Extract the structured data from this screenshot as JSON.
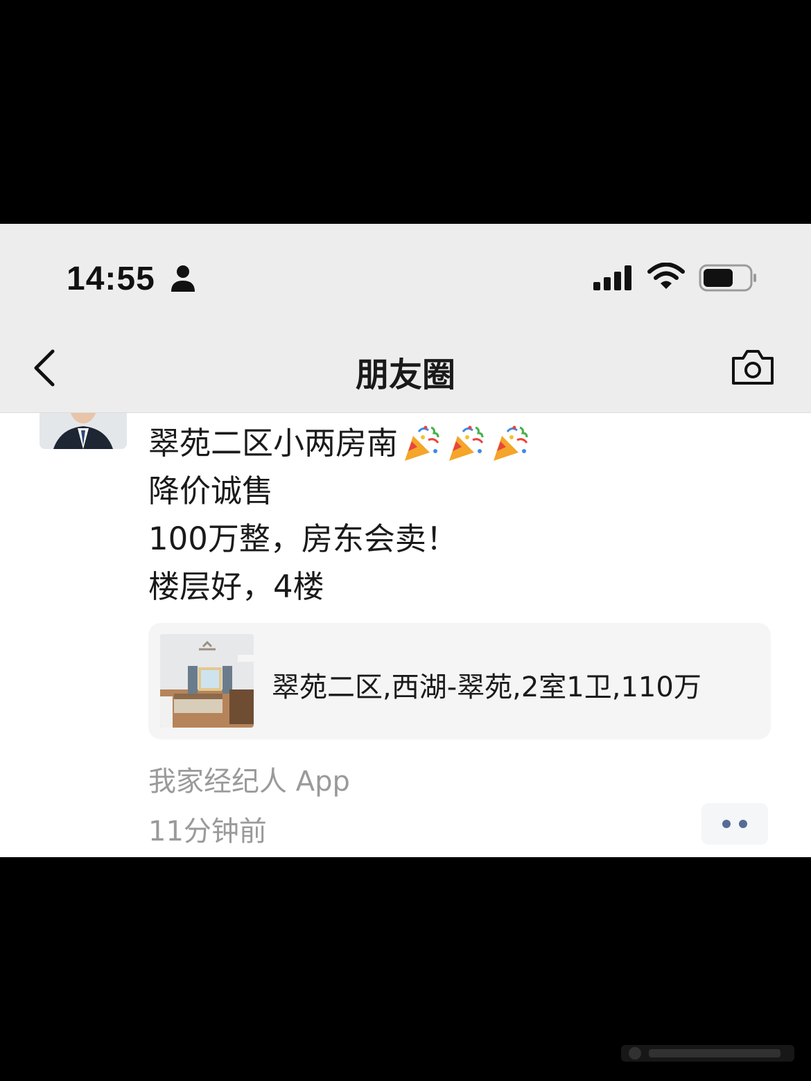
{
  "status_bar": {
    "time": "14:55"
  },
  "nav": {
    "title": "朋友圈"
  },
  "post": {
    "lines": [
      "翠苑二区小两房南",
      "降价诚售",
      "100万整，房东会卖！",
      "楼层好，4楼"
    ],
    "link": {
      "title": "翠苑二区,西湖-翠苑,2室1卫,110万"
    },
    "source": "我家经纪人 App",
    "time_ago": "11分钟前"
  },
  "colors": {
    "header_bg": "#ededed",
    "link_blue": "#576b95",
    "meta_gray": "#9a9a9a"
  }
}
